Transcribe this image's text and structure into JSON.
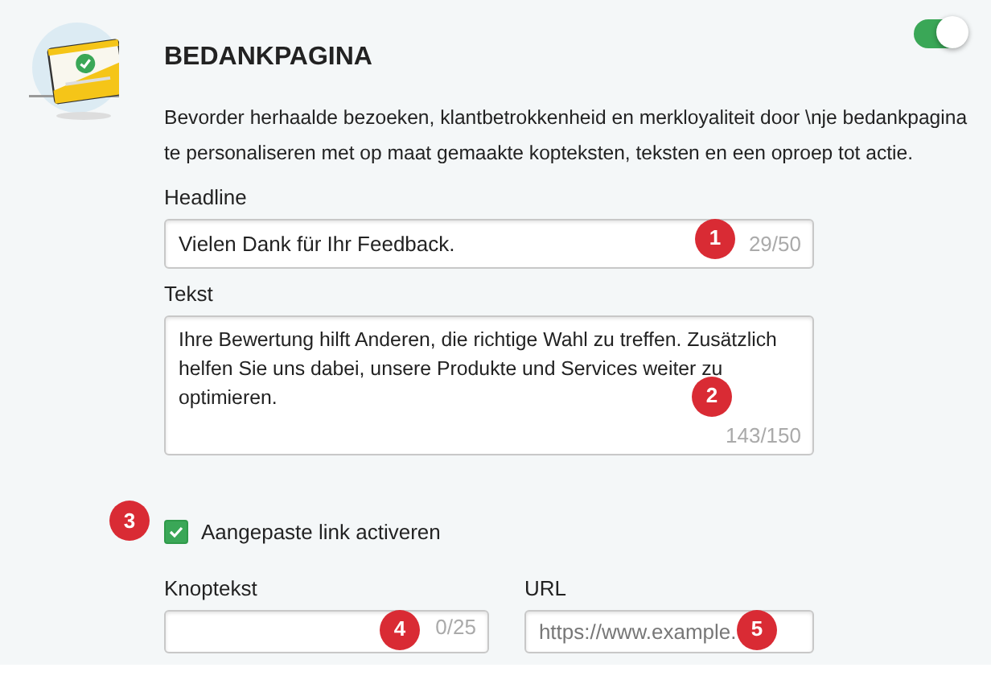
{
  "panel": {
    "title": "BEDANKPAGINA",
    "enabled": true,
    "description": "Bevorder herhaalde bezoeken, klantbetrokkenheid en merkloyaliteit door \\nje bedankpagina te personaliseren met op maat gemaakte kopteksten, teksten en een oproep tot actie."
  },
  "headline": {
    "label": "Headline",
    "value": "Vielen Dank für Ihr Feedback.",
    "counter": "29/50",
    "marker": "1"
  },
  "text": {
    "label": "Tekst",
    "value": "Ihre Bewertung hilft Anderen, die richtige Wahl zu treffen. Zusätzlich helfen Sie uns dabei, unsere Produkte und Services weiter zu optimieren.",
    "counter": "143/150",
    "marker": "2"
  },
  "custom_link": {
    "label": "Aangepaste link activeren",
    "checked": true,
    "marker": "3"
  },
  "button_text": {
    "label": "Knoptekst",
    "counter": "0/25",
    "marker": "4"
  },
  "url": {
    "label": "URL",
    "placeholder": "https://www.example.",
    "marker": "5"
  }
}
